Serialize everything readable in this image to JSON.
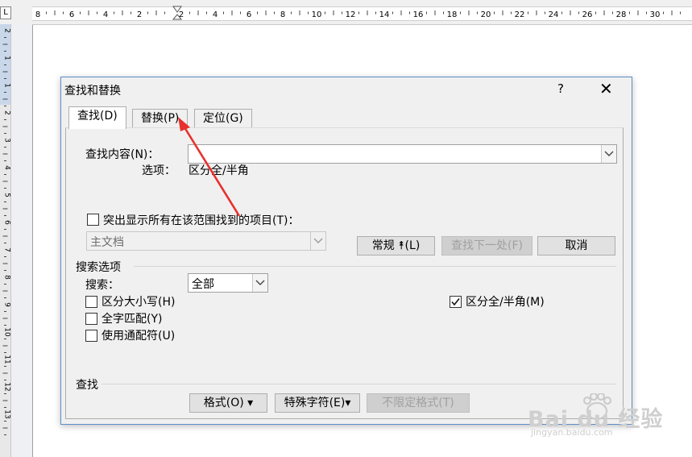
{
  "ruler": {
    "top_numbers": [
      "8",
      "6",
      "4",
      "2",
      "2",
      "4",
      "6",
      "8",
      "10",
      "12",
      "14",
      "16",
      "18",
      "20",
      "22",
      "24",
      "26",
      "28",
      "30"
    ],
    "left_numbers": [
      "2",
      "1",
      "1",
      "2",
      "3",
      "4",
      "5",
      "6",
      "7",
      "8",
      "9",
      "10",
      "11",
      "12",
      "13"
    ],
    "corner": "L"
  },
  "dialog": {
    "title": "查找和替换",
    "help": "?",
    "close": "✕",
    "tabs": [
      {
        "label": "查找(D)"
      },
      {
        "label": "替换(P)"
      },
      {
        "label": "定位(G)"
      }
    ],
    "find_label": "查找内容(N)：",
    "find_value": "",
    "options_label": "选项：",
    "options_value": "区分全/半角",
    "highlight_label": "突出显示所有在该范围找到的项目(T)：",
    "scope_value": "主文档",
    "buttons": {
      "normal": "常规 ⯭(L)",
      "find_next": "查找下一处(F)",
      "cancel": "取消"
    },
    "search_options_title": "搜索选项",
    "search_label": "搜索：",
    "search_value": "全部",
    "checkboxes": {
      "match_case": "区分大小写(H)",
      "whole_word": "全字匹配(Y)",
      "wildcards": "使用通配符(U)",
      "width": "区分全/半角(M)"
    },
    "find_section_title": "查找",
    "bottom_buttons": {
      "format": "格式(O) ▾",
      "special": "特殊字符(E)▾",
      "no_format": "不限定格式(T)"
    }
  },
  "watermark": {
    "brand": "Bai du 经验",
    "url": "jingyan.baidu.com"
  },
  "colors": {
    "dialog_border": "#5b8ec9",
    "annotation_arrow": "#e8302c"
  }
}
